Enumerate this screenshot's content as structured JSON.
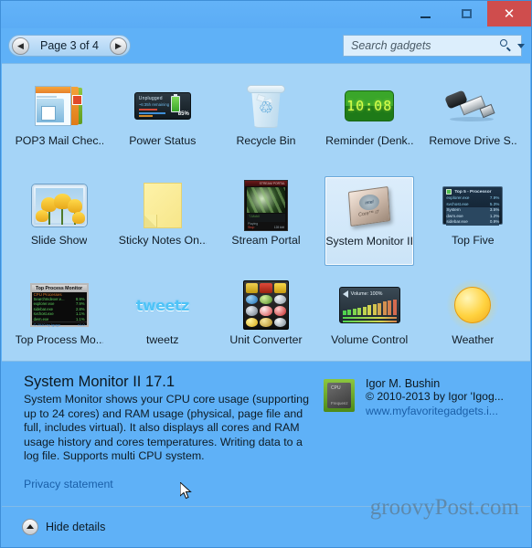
{
  "window": {
    "buttons": {
      "minimize": "minimize-button",
      "maximize": "maximize-button",
      "close": "✕"
    }
  },
  "toolbar": {
    "prev_label": "◀",
    "next_label": "▶",
    "page_label": "Page 3 of 4",
    "search_placeholder": "Search gadgets",
    "search_value": ""
  },
  "gadgets": [
    {
      "name": "POP3 Mail Chec...",
      "icon": "pop3-mail-icon",
      "selected": false
    },
    {
      "name": "Power Status",
      "icon": "power-status-icon",
      "selected": false,
      "thumb": {
        "title": "Unplugged",
        "sub": "~6:35h remaining",
        "percent": "85%",
        "labels": [
          "Battery",
          "Highest",
          "Advanced",
          "Perform."
        ]
      }
    },
    {
      "name": "Recycle Bin",
      "icon": "recycle-bin-icon",
      "selected": false
    },
    {
      "name": "Reminder (Denk...",
      "icon": "reminder-clock-icon",
      "selected": false,
      "thumb": {
        "time": "10:08"
      }
    },
    {
      "name": "Remove Drive S...",
      "icon": "usb-drive-icon",
      "selected": false
    },
    {
      "name": "Slide Show",
      "icon": "slide-show-icon",
      "selected": false
    },
    {
      "name": "Sticky Notes On...",
      "icon": "sticky-note-icon",
      "selected": false
    },
    {
      "name": "Stream Portal",
      "icon": "stream-portal-icon",
      "selected": false,
      "thumb": {
        "title": "STREAM PORTAL",
        "station": "T-Mobil",
        "status": "Playing",
        "now": "Stop"
      }
    },
    {
      "name": "System Monitor II",
      "icon": "cpu-chip-icon",
      "selected": true,
      "thumb": {
        "brand": "intel",
        "model": "Core™ i7"
      }
    },
    {
      "name": "Top Five",
      "icon": "top-five-icon",
      "selected": false,
      "thumb": {
        "title": "Top 5 - Processor",
        "rows": [
          {
            "proc": "explorer.exe",
            "pct": "7.9%"
          },
          {
            "proc": "svchost.exe",
            "pct": "5.3%"
          },
          {
            "proc": "System",
            "pct": "3.5%"
          },
          {
            "proc": "dwm.exe",
            "pct": "1.2%"
          },
          {
            "proc": "sidebar.exe",
            "pct": "0.9%"
          }
        ]
      }
    },
    {
      "name": "Top Process Mo...",
      "icon": "top-process-monitor-icon",
      "selected": false,
      "thumb": {
        "title": "Top Process Monitor",
        "subtitle": "CPU Processes",
        "rows": [
          {
            "proc": "SearchIndexer.e...",
            "pct": "8.9%"
          },
          {
            "proc": "explorer.exe",
            "pct": "7.9%"
          },
          {
            "proc": "sidebar.exe",
            "pct": "2.8%"
          },
          {
            "proc": "svchost.exe",
            "pct": "1.1%"
          },
          {
            "proc": "dwm.exe",
            "pct": "1.1%"
          }
        ],
        "footer_left": "© 2010 by Igogo",
        "footer_right": "v1.0"
      }
    },
    {
      "name": "tweetz",
      "icon": "tweetz-icon",
      "selected": false,
      "thumb": {
        "wordmark": "tweetz"
      }
    },
    {
      "name": "Unit Converter",
      "icon": "unit-converter-icon",
      "selected": false
    },
    {
      "name": "Volume Control",
      "icon": "volume-control-icon",
      "selected": false,
      "thumb": {
        "title": "Volume: 100%"
      }
    },
    {
      "name": "Weather",
      "icon": "weather-sun-icon",
      "selected": false
    }
  ],
  "details": {
    "title": "System Monitor II 17.1",
    "description": "System Monitor shows your CPU core usage (supporting up to 24 cores) and RAM usage (physical, page file and full, includes virtual). It also displays all cores and RAM usage history and cores temperatures. Writing data to a log file. Supports multi CPU system.",
    "privacy_link": "Privacy statement",
    "publisher_name": "Igor M. Bushin",
    "publisher_copyright": "© 2010-2013 by Igor 'Igog...",
    "publisher_url": "www.myfavoritegadgets.i...",
    "publisher_icon_top": "CPU",
    "publisher_icon_bottom": "Frequenz"
  },
  "footer": {
    "hide_details_label": "Hide details"
  },
  "watermark": "groovyPost.com",
  "colors": {
    "window_bg": "#5fb1f7",
    "grid_bg": "#a5d4f7",
    "accent_link": "#1a5fa8",
    "close_button": "#cf4d4d",
    "selection_border": "#6aa7d8"
  }
}
